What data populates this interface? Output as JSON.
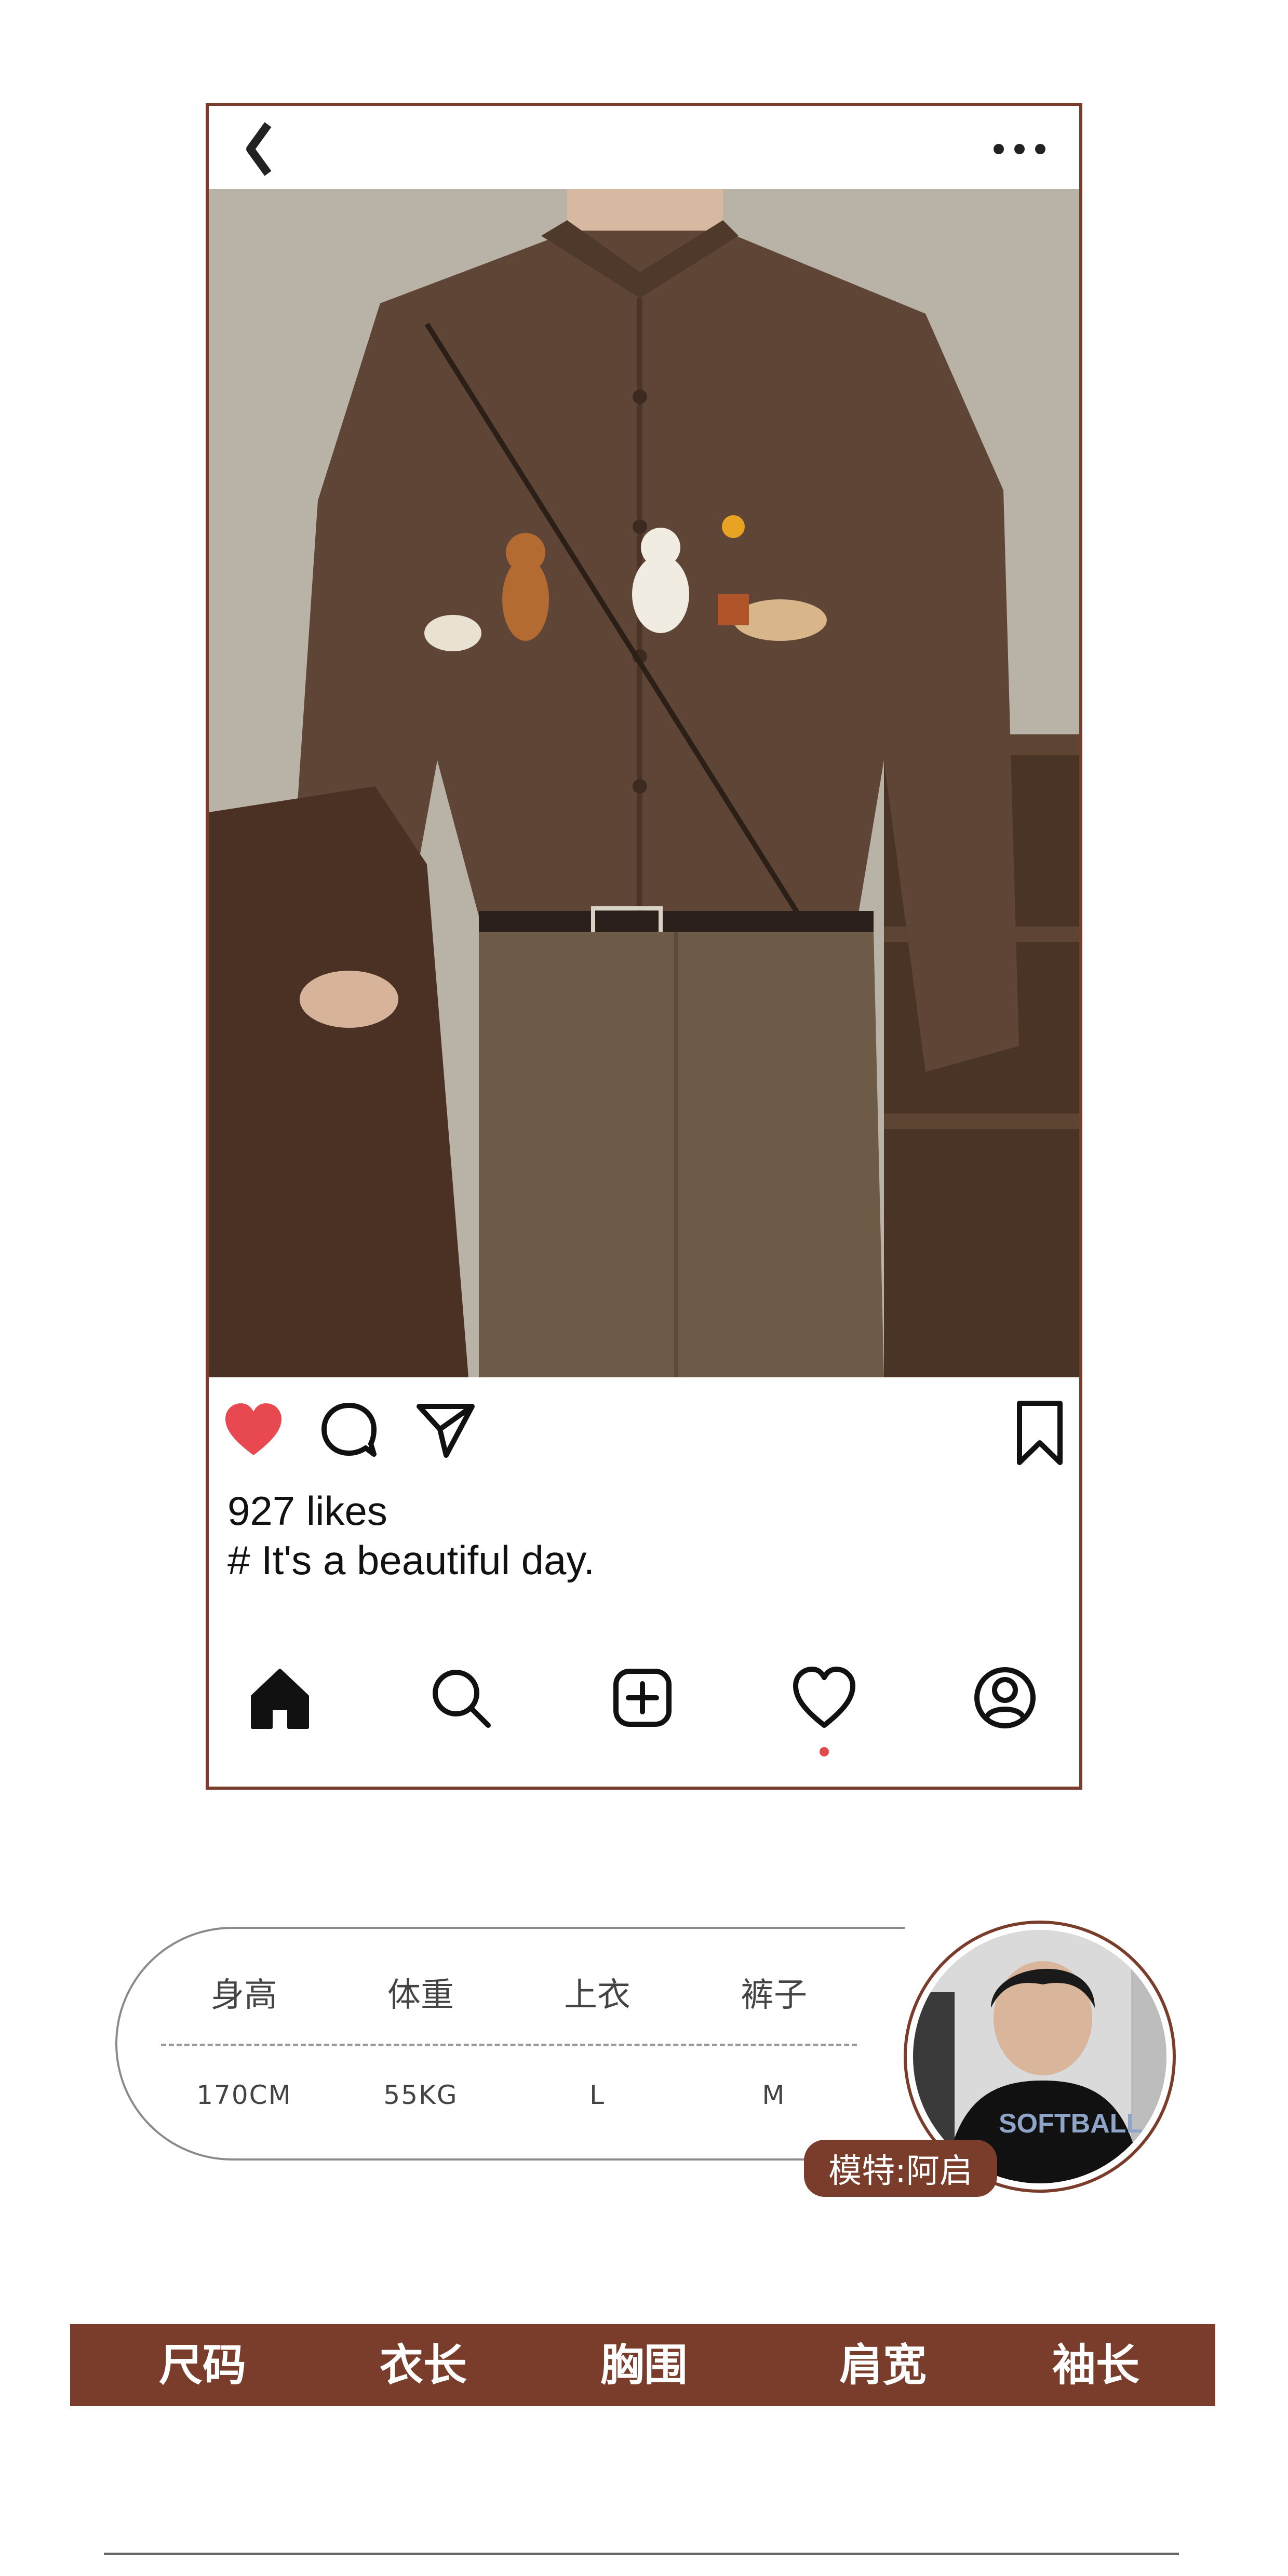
{
  "post": {
    "likes": "927 likes",
    "caption": "# It's a beautiful day.",
    "liked": true
  },
  "icons": {
    "back": "chevron-left-icon",
    "more": "more-dots-icon",
    "like": "heart-filled-icon",
    "comment": "comment-icon",
    "share": "send-icon",
    "save": "bookmark-icon",
    "nav": [
      "home-icon",
      "search-icon",
      "add-post-icon",
      "heart-icon",
      "profile-icon"
    ]
  },
  "bottom_nav": {
    "active_dot_under": "heart-icon"
  },
  "model": {
    "labels": [
      "身高",
      "体重",
      "上衣",
      "裤子"
    ],
    "values": [
      "170CM",
      "55KG",
      "L",
      "M"
    ],
    "tag": "模特:阿启"
  },
  "size_table": {
    "headers": [
      "尺码",
      "衣长",
      "胸围",
      "肩宽",
      "袖长"
    ]
  },
  "colors": {
    "accent": "#7a3d2c",
    "like": "#e8484f",
    "dot": "#e04a4a"
  }
}
